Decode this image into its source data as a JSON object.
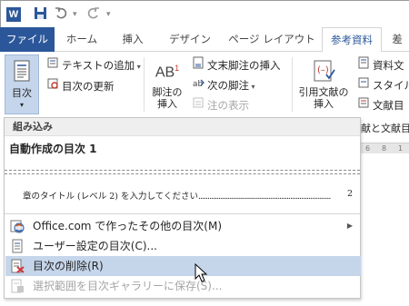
{
  "app": {
    "logo": "W"
  },
  "tabs": [
    "ファイル",
    "ホーム",
    "挿入",
    "デザイン",
    "ページ レイアウト",
    "参考資料",
    "差"
  ],
  "ribbon": {
    "toc_button": "目次",
    "add_text": "テキストの追加",
    "update_toc": "目次の更新",
    "footnote_label_1": "脚注の",
    "footnote_label_2": "挿入",
    "insert_endnote": "文末脚注の挿入",
    "next_footnote": "次の脚注",
    "show_notes": "注の表示",
    "citation_label_1": "引用文献の",
    "citation_label_2": "挿入",
    "source_mgmt": "資料文",
    "style": "スタイル",
    "bibliography": "文献目",
    "bib_text": "献と文献目",
    "ab_text": "AB",
    "ab_sup": "1"
  },
  "dropdown": {
    "header": "組み込み",
    "gallery_title": "自動作成の目次 1",
    "toc_entry": "章のタイトル (レベル 2) を入力してください",
    "toc_page": "2",
    "items": [
      {
        "label": "Office.com で作ったその他の目次(M)"
      },
      {
        "label": "ユーザー設定の目次(C)..."
      },
      {
        "label": "目次の削除(R)"
      },
      {
        "label": "選択範囲を目次ギャラリーに保存(S)..."
      }
    ]
  },
  "ruler_marks": [
    "6",
    "8",
    "1"
  ]
}
